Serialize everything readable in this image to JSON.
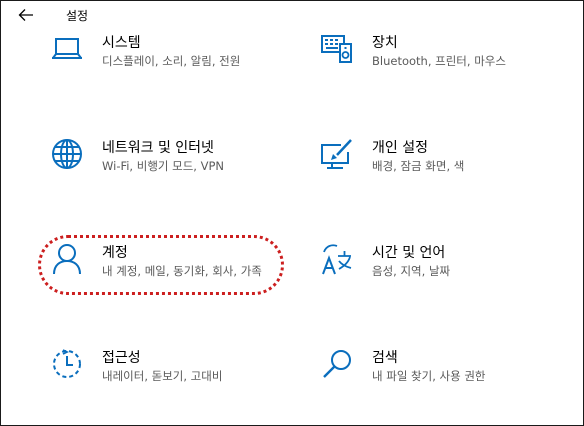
{
  "window": {
    "title": "설정"
  },
  "tiles": [
    {
      "name": "시스템",
      "desc": "디스플레이, 소리, 알림, 전원",
      "icon": "laptop-icon"
    },
    {
      "name": "장치",
      "desc": "Bluetooth, 프린터, 마우스",
      "icon": "devices-icon"
    },
    {
      "name": "네트워크 및 인터넷",
      "desc": "Wi-Fi, 비행기 모드, VPN",
      "icon": "globe-icon"
    },
    {
      "name": "개인 설정",
      "desc": "배경, 잠금 화면, 색",
      "icon": "personalization-icon"
    },
    {
      "name": "계정",
      "desc": "내 계정, 메일, 동기화, 회사, 가족",
      "icon": "account-icon"
    },
    {
      "name": "시간 및 언어",
      "desc": "음성, 지역, 날짜",
      "icon": "time-language-icon"
    },
    {
      "name": "접근성",
      "desc": "내레이터, 돋보기, 고대비",
      "icon": "accessibility-icon"
    },
    {
      "name": "검색",
      "desc": "내 파일 찾기, 사용 권한",
      "icon": "search-icon"
    }
  ],
  "colors": {
    "accent": "#0a6ebd",
    "highlight": "#cc1f1f"
  }
}
